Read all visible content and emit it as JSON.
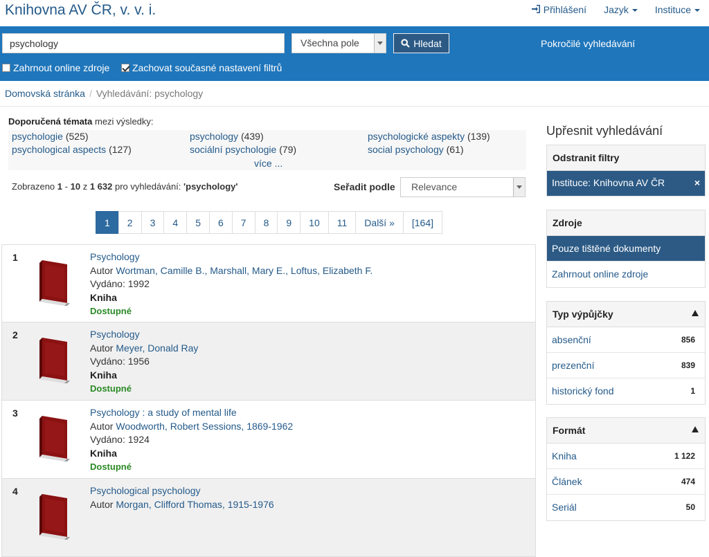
{
  "header": {
    "brand": "Knihovna AV ČR, v. v. i.",
    "nav": [
      {
        "label": "Přihlášení",
        "icon": "sign-in-icon"
      },
      {
        "label": "Jazyk",
        "icon": "caret-down-icon"
      },
      {
        "label": "Instituce",
        "icon": "caret-down-icon"
      }
    ]
  },
  "search": {
    "query": "psychology",
    "field_select": "Všechna pole",
    "button_label": "Hledat",
    "advanced_label": "Pokročilé vyhledávání",
    "include_online_label": "Zahrnout online zdroje",
    "include_online_checked": false,
    "keep_filters_label": "Zachovat současné nastavení filtrů",
    "keep_filters_checked": true
  },
  "breadcrumb": {
    "home": "Domovská stránka",
    "current": "Vyhledávání: psychology"
  },
  "topics": {
    "head_bold": "Doporučená témata",
    "head_rest": "mezi výsledky:",
    "items": [
      {
        "label": "psychologie",
        "count": "(525)"
      },
      {
        "label": "psychology",
        "count": "(439)"
      },
      {
        "label": "psychologické aspekty",
        "count": "(139)"
      },
      {
        "label": "psychological aspects",
        "count": "(127)"
      },
      {
        "label": "sociální psychologie",
        "count": "(79)"
      },
      {
        "label": "social psychology",
        "count": "(61)"
      }
    ],
    "more": "více ..."
  },
  "summary": {
    "prefix": "Zobrazeno",
    "from": "1",
    "dash": "-",
    "to": "10",
    "of": "z",
    "total": "1 632",
    "for": "pro vyhledávání:",
    "query": "'psychology'",
    "sort_label": "Seřadit podle",
    "sort_value": "Relevance"
  },
  "pagination": [
    "1",
    "2",
    "3",
    "4",
    "5",
    "6",
    "7",
    "8",
    "9",
    "10",
    "11",
    "Další »",
    "[164]"
  ],
  "results": [
    {
      "num": "1",
      "title": "Psychology",
      "author_prefix": "Autor",
      "author": "Wortman, Camille B., Marshall, Mary E., Loftus, Elizabeth F.",
      "published": "Vydáno: 1992",
      "kind": "Kniha",
      "status": "Dostupné"
    },
    {
      "num": "2",
      "title": "Psychology",
      "author_prefix": "Autor",
      "author": "Meyer, Donald Ray",
      "published": "Vydáno: 1956",
      "kind": "Kniha",
      "status": "Dostupné"
    },
    {
      "num": "3",
      "title": "Psychology : a study of mental life",
      "author_prefix": "Autor",
      "author": "Woodworth, Robert Sessions, 1869-1962",
      "published": "Vydáno: 1924",
      "kind": "Kniha",
      "status": "Dostupné"
    },
    {
      "num": "4",
      "title": "Psychological psychology",
      "author_prefix": "Autor",
      "author": "Morgan, Clifford Thomas, 1915-1976",
      "published": "",
      "kind": "",
      "status": ""
    }
  ],
  "sidebar": {
    "title": "Upřesnit vyhledávání",
    "remove_filters": {
      "head": "Odstranit filtry",
      "active": "Instituce: Knihovna AV ČR",
      "remove_icon": "×"
    },
    "sources": {
      "head": "Zdroje",
      "items": [
        "Pouze tištěné dokumenty",
        "Zahrnout online zdroje"
      ]
    },
    "loan_type": {
      "head": "Typ výpůjčky",
      "items": [
        {
          "label": "absenční",
          "count": "856"
        },
        {
          "label": "prezenční",
          "count": "839"
        },
        {
          "label": "historický fond",
          "count": "1"
        }
      ]
    },
    "format": {
      "head": "Formát",
      "items": [
        {
          "label": "Kniha",
          "count": "1 122"
        },
        {
          "label": "Článek",
          "count": "474"
        },
        {
          "label": "Seriál",
          "count": "50"
        }
      ]
    }
  },
  "colors": {
    "header_blue": "#1f76bb",
    "link": "#245a8a",
    "active_dark": "#2c5a85",
    "available_green": "#2b8a26"
  }
}
